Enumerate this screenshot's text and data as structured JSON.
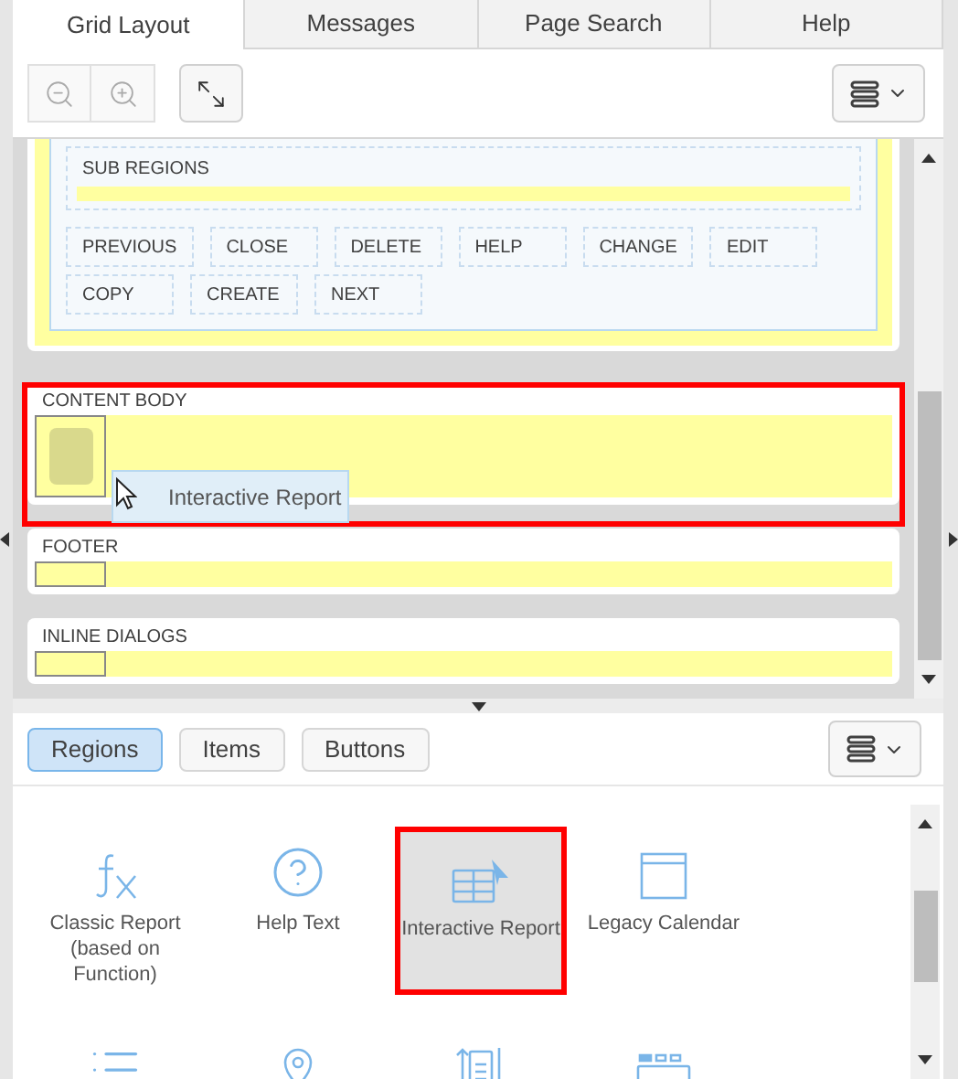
{
  "tabs": [
    {
      "label": "Grid Layout",
      "selected": true
    },
    {
      "label": "Messages",
      "selected": false
    },
    {
      "label": "Page Search",
      "selected": false
    },
    {
      "label": "Help",
      "selected": false
    }
  ],
  "layout_canvas": {
    "sub_regions_label": "SUB REGIONS",
    "region_buttons": [
      "PREVIOUS",
      "CLOSE",
      "DELETE",
      "HELP",
      "CHANGE",
      "EDIT",
      "COPY",
      "CREATE",
      "NEXT"
    ],
    "positions": [
      {
        "label": "CONTENT BODY",
        "highlighted": true,
        "kind": "tall"
      },
      {
        "label": "FOOTER",
        "highlighted": false,
        "kind": "slot"
      },
      {
        "label": "INLINE DIALOGS",
        "highlighted": false,
        "kind": "slot"
      }
    ],
    "drag_preview": {
      "label": "Interactive Report"
    }
  },
  "gallery_tabs": [
    {
      "label": "Regions",
      "selected": true
    },
    {
      "label": "Items",
      "selected": false
    },
    {
      "label": "Buttons",
      "selected": false
    }
  ],
  "gallery_items": [
    {
      "label": "Classic Report (based on Function)",
      "kind": "function",
      "selected": false
    },
    {
      "label": "Help Text",
      "kind": "help",
      "selected": false
    },
    {
      "label": "Interactive Report",
      "kind": "report",
      "selected": true
    },
    {
      "label": "Legacy Calendar",
      "kind": "calendar",
      "selected": false
    },
    {
      "kind": "list",
      "selected": false
    },
    {
      "kind": "map",
      "selected": false
    },
    {
      "kind": "scroll",
      "selected": false
    },
    {
      "kind": "tabs",
      "selected": false
    }
  ]
}
